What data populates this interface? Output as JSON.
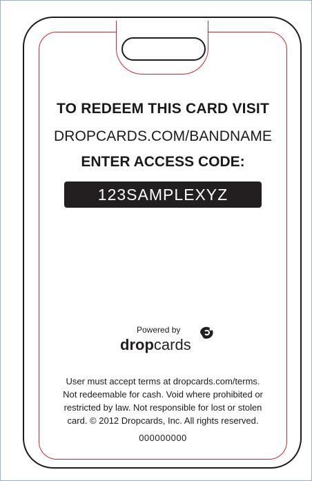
{
  "card": {
    "line1": "TO REDEEM THIS CARD VISIT",
    "line2": "DROPCARDS.COM/BANDNAME",
    "line3": "ENTER ACCESS CODE:",
    "access_code": "123SAMPLEXYZ",
    "powered_by": "Powered by",
    "logo_bold": "drop",
    "logo_light": "cards",
    "terms": [
      "User must accept terms at dropcards.com/terms.",
      "Not redeemable for cash.  Void where prohibited or",
      "restricted by law. Not responsible for lost or stolen",
      "card. © 2012 Dropcards, Inc.  All rights reserved."
    ],
    "serial": "000000000"
  },
  "colors": {
    "outline": "#1a1a1a",
    "inner_line": "#d3262e",
    "code_bg": "#231f20",
    "frame_border": "#8fb0d8"
  },
  "icons": {
    "logo_icon": "dropcards-logo-icon"
  }
}
